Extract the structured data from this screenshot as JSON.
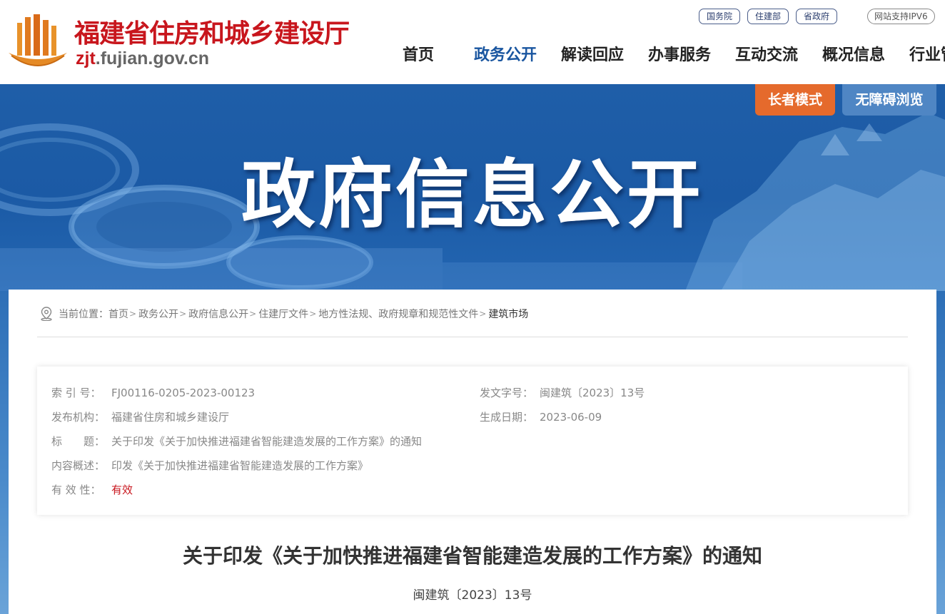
{
  "header": {
    "site_name": "福建省住房和城乡建设厅",
    "domain_prefix": "zjt",
    "domain_rest": ".fujian.gov.cn",
    "top_links": [
      "国务院",
      "住建部",
      "省政府"
    ],
    "ipv6": "网站支持IPV6",
    "nav": [
      "首页",
      "政务公开",
      "解读回应",
      "办事服务",
      "互动交流",
      "概况信息",
      "行业管理"
    ],
    "active_nav": "政务公开"
  },
  "banner": {
    "title": "政府信息公开",
    "elder_mode": "长者模式",
    "accessible": "无障碍浏览"
  },
  "breadcrumb": {
    "prefix": "当前位置：",
    "items": [
      "首页",
      "政务公开",
      "政府信息公开",
      "住建厅文件",
      "地方性法规、政府规章和规范性文件",
      "建筑市场"
    ]
  },
  "meta": {
    "index_label": "索 引 号：",
    "index_value": "FJ00116-0205-2023-00123",
    "doc_no_label": "发文字号：",
    "doc_no_value": "闽建筑〔2023〕13号",
    "publisher_label": "发布机构：",
    "publisher_value": "福建省住房和城乡建设厅",
    "date_label": "生成日期：",
    "date_value": "2023-06-09",
    "title_label": "标　　题：",
    "title_value": "关于印发《关于加快推进福建省智能建造发展的工作方案》的通知",
    "summary_label": "内容概述：",
    "summary_value": "印发《关于加快推进福建省智能建造发展的工作方案》",
    "validity_label": "有 效 性：",
    "validity_value": "有效"
  },
  "document": {
    "title": "关于印发《关于加快推进福建省智能建造发展的工作方案》的通知",
    "number": "闽建筑〔2023〕13号"
  },
  "colors": {
    "brand_red": "#c8161d",
    "nav_active": "#1a56a0",
    "banner_blue": "#1f5ea8",
    "elder_orange": "#e56a2c",
    "access_blue": "#4f86c4"
  }
}
